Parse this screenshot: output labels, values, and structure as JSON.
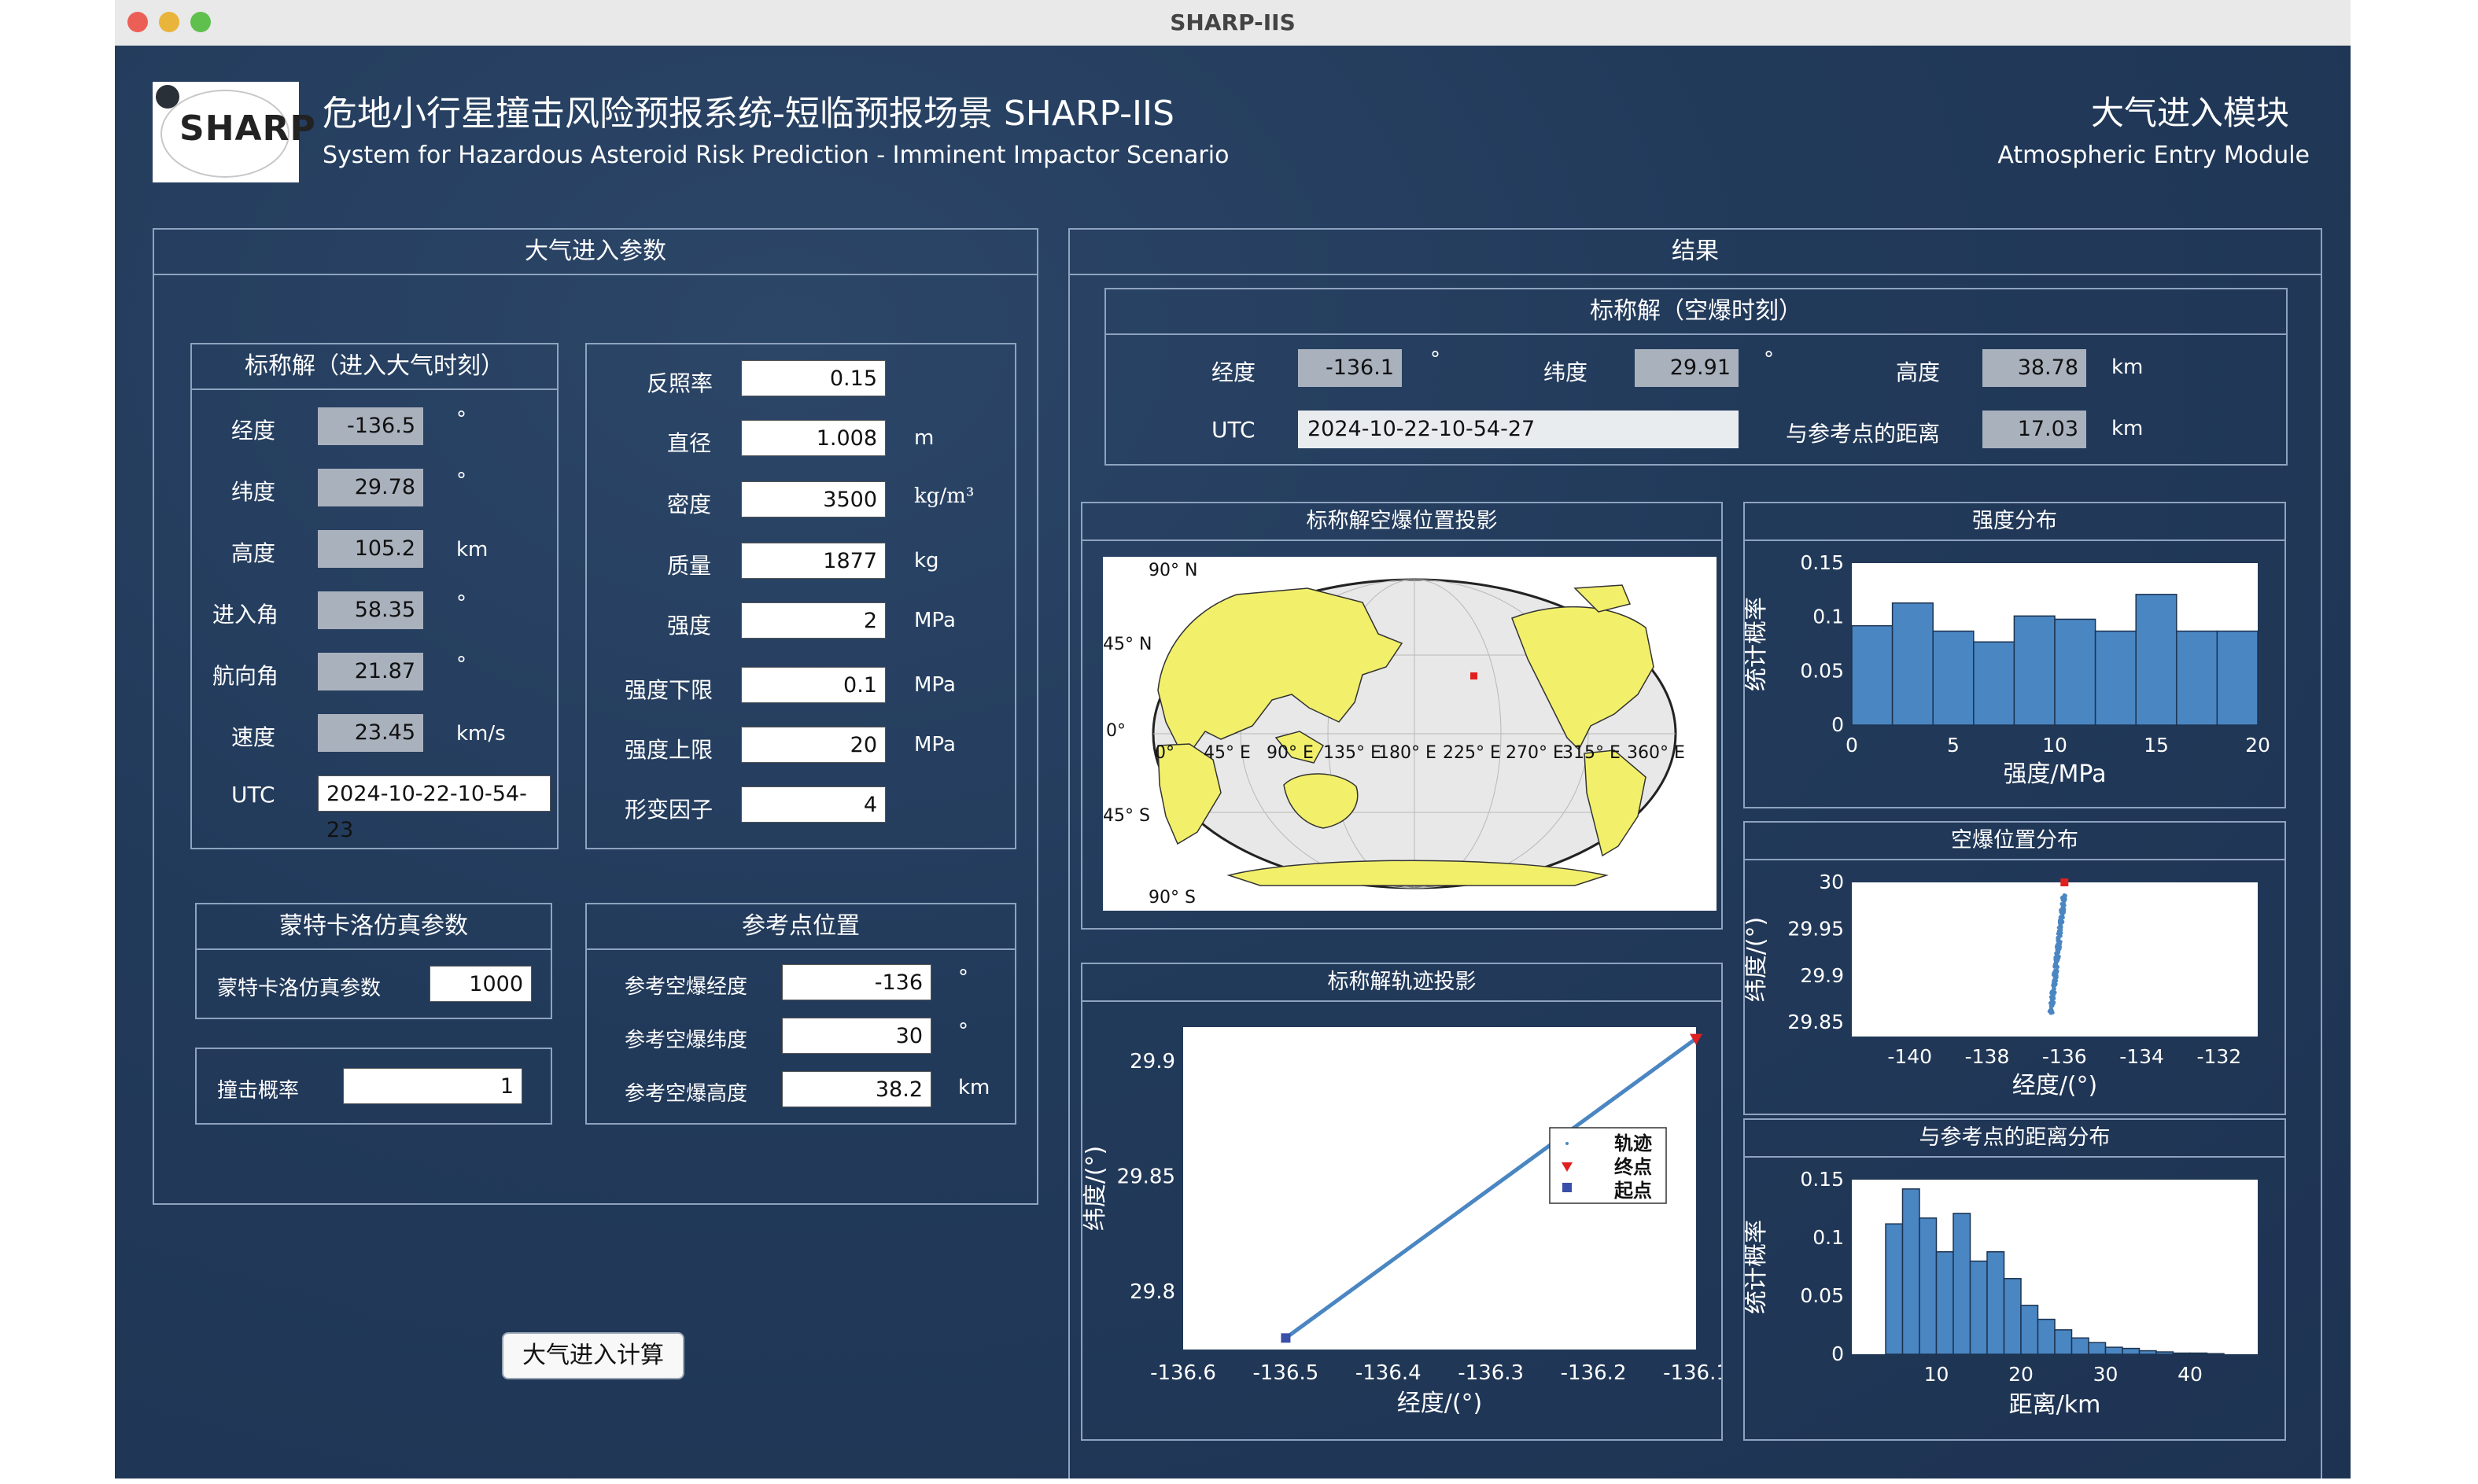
{
  "window": {
    "title": "SHARP-IIS"
  },
  "header": {
    "logo_text": "SHARP",
    "title_cn": "危地小行星撞击风险预报系统-短临预报场景 SHARP-IIS",
    "title_en": "System for Hazardous Asteroid Risk Prediction - Imminent Impactor Scenario",
    "module_cn": "大气进入模块",
    "module_en": "Atmospheric Entry Module"
  },
  "params": {
    "title": "大气进入参数",
    "nominal": {
      "title": "标称解（进入大气时刻）",
      "rows": [
        {
          "label": "经度",
          "value": "-136.5",
          "unit": "°"
        },
        {
          "label": "纬度",
          "value": "29.78",
          "unit": "°"
        },
        {
          "label": "高度",
          "value": "105.2",
          "unit": "km"
        },
        {
          "label": "进入角",
          "value": "58.35",
          "unit": "°"
        },
        {
          "label": "航向角",
          "value": "21.87",
          "unit": "°"
        },
        {
          "label": "速度",
          "value": "23.45",
          "unit": "km/s"
        }
      ],
      "utc_label": "UTC",
      "utc_value": "2024-10-22-10-54-23"
    },
    "physical": {
      "rows": [
        {
          "label": "反照率",
          "value": "0.15",
          "unit": ""
        },
        {
          "label": "直径",
          "value": "1.008",
          "unit": "m"
        },
        {
          "label": "密度",
          "value": "3500",
          "unit": "kg/m³"
        },
        {
          "label": "质量",
          "value": "1877",
          "unit": "kg"
        },
        {
          "label": "强度",
          "value": "2",
          "unit": "MPa"
        },
        {
          "label": "强度下限",
          "value": "0.1",
          "unit": "MPa"
        },
        {
          "label": "强度上限",
          "value": "20",
          "unit": "MPa"
        },
        {
          "label": "形变因子",
          "value": "4",
          "unit": ""
        }
      ]
    },
    "montecarlo": {
      "title": "蒙特卡洛仿真参数",
      "label": "蒙特卡洛仿真参数",
      "value": "1000"
    },
    "impact": {
      "label": "撞击概率",
      "value": "1"
    },
    "reference": {
      "title": "参考点位置",
      "rows": [
        {
          "label": "参考空爆经度",
          "value": "-136",
          "unit": "°"
        },
        {
          "label": "参考空爆纬度",
          "value": "30",
          "unit": "°"
        },
        {
          "label": "参考空爆高度",
          "value": "38.2",
          "unit": "km"
        }
      ]
    },
    "compute_button": "大气进入计算"
  },
  "results": {
    "title": "结果",
    "nominal": {
      "title": "标称解（空爆时刻）",
      "lon_label": "经度",
      "lon_value": "-136.1",
      "lon_unit": "°",
      "lat_label": "纬度",
      "lat_value": "29.91",
      "lat_unit": "°",
      "alt_label": "高度",
      "alt_value": "38.78",
      "alt_unit": "km",
      "utc_label": "UTC",
      "utc_value": "2024-10-22-10-54-27",
      "dist_label": "与参考点的距离",
      "dist_value": "17.03",
      "dist_unit": "km"
    },
    "map": {
      "title": "标称解空爆位置投影",
      "lat_labels": [
        "90° N",
        "45° N",
        "0°",
        "45° S",
        "90° S"
      ],
      "lon_labels": [
        "0°",
        "45° E",
        "90° E",
        "135° E",
        "180° E",
        "225° E",
        "270° E",
        "315° E",
        "360° E"
      ]
    },
    "trajectory": {
      "title": "标称解轨迹投影"
    },
    "strength": {
      "title": "强度分布"
    },
    "burst": {
      "title": "空爆位置分布"
    },
    "distance": {
      "title": "与参考点的距离分布"
    }
  },
  "colors": {
    "window_bg": "#233a5a",
    "bar": "#4a86c2",
    "bar_edge": "#1c3350",
    "land": "#f2f06a",
    "ocean": "#e8e8e8",
    "marker_red": "#e02020",
    "marker_blue": "#3a4fa8"
  },
  "chart_data": [
    {
      "type": "bar",
      "title": "强度分布",
      "xlabel": "强度/MPa",
      "ylabel": "统计概率",
      "xlim": [
        0,
        20
      ],
      "ylim": [
        0,
        0.15
      ],
      "xticks": [
        0,
        5,
        10,
        15,
        20
      ],
      "yticks": [
        0,
        0.05,
        0.1,
        0.15
      ],
      "bin_edges": [
        0,
        2,
        4,
        6,
        8,
        10,
        12,
        14,
        16,
        18,
        20
      ],
      "values": [
        0.092,
        0.113,
        0.087,
        0.077,
        0.101,
        0.098,
        0.087,
        0.121,
        0.087,
        0.087
      ]
    },
    {
      "type": "scatter",
      "title": "空爆位置分布",
      "xlabel": "经度/(°)",
      "ylabel": "纬度/(°)",
      "xlim": [
        -141.5,
        -131
      ],
      "ylim": [
        29.835,
        30
      ],
      "xticks": [
        -140,
        -138,
        -136,
        -134,
        -132
      ],
      "yticks": [
        29.85,
        29.9,
        29.95,
        30
      ],
      "cluster_x_range": [
        -136.35,
        -136.0
      ],
      "cluster_y_range": [
        29.86,
        29.99
      ],
      "points": [
        {
          "name": "参考点",
          "x": -136,
          "y": 30,
          "color": "#e02020"
        }
      ]
    },
    {
      "type": "line",
      "title": "标称解轨迹投影",
      "xlabel": "经度/(°)",
      "ylabel": "纬度/(°)",
      "xlim": [
        -136.6,
        -136.1
      ],
      "ylim": [
        29.775,
        29.915
      ],
      "xticks": [
        -136.6,
        -136.5,
        -136.4,
        -136.3,
        -136.2,
        -136.1
      ],
      "yticks": [
        29.8,
        29.85,
        29.9
      ],
      "legend": [
        "轨迹",
        "终点",
        "起点"
      ],
      "legend_location": "right",
      "series": [
        {
          "name": "轨迹",
          "x": [
            -136.5,
            -136.1
          ],
          "y": [
            29.78,
            29.91
          ]
        },
        {
          "name": "终点",
          "x": [
            -136.1
          ],
          "y": [
            29.91
          ]
        },
        {
          "name": "起点",
          "x": [
            -136.5
          ],
          "y": [
            29.78
          ]
        }
      ]
    },
    {
      "type": "bar",
      "title": "与参考点的距离分布",
      "xlabel": "距离/km",
      "ylabel": "统计概率",
      "xlim": [
        0,
        48
      ],
      "ylim": [
        0,
        0.15
      ],
      "xticks": [
        10,
        20,
        30,
        40
      ],
      "yticks": [
        0,
        0.05,
        0.1,
        0.15
      ],
      "bin_edges": [
        4,
        6,
        8,
        10,
        12,
        14,
        16,
        18,
        20,
        22,
        24,
        26,
        28,
        30,
        32,
        34,
        36,
        38,
        40,
        42,
        44
      ],
      "values": [
        0.112,
        0.142,
        0.117,
        0.088,
        0.121,
        0.08,
        0.088,
        0.065,
        0.042,
        0.03,
        0.021,
        0.014,
        0.01,
        0.006,
        0.005,
        0.003,
        0.002,
        0.001,
        0.001,
        0.0005
      ]
    }
  ]
}
